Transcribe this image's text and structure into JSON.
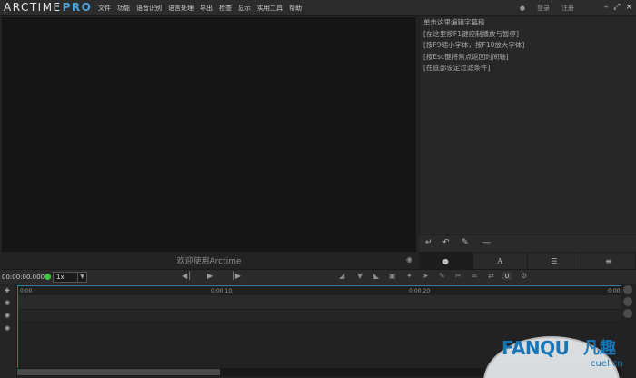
{
  "app": {
    "logo_main": "ARCTIME",
    "logo_accent": "PRO",
    "menu": [
      "文件",
      "功能",
      "语音识别",
      "语言处理",
      "导出",
      "检查",
      "显示",
      "实用工具",
      "帮助"
    ],
    "login": "登录",
    "register": "注册",
    "minimize": "–",
    "maximize": "⤢",
    "close": "×"
  },
  "video": {
    "welcome": "欢迎使用Arctime"
  },
  "editor": {
    "lines": [
      "单击这里编辑字幕稿",
      "[在这里按F1键控制播放与暂停]",
      "[按F9缩小字体，按F10放大字体]",
      "[按Esc键将焦点返回时间轴]",
      "[在底部设定过滤条件]"
    ],
    "tab_font_label": "A"
  },
  "transport": {
    "timecode": "00:00:00.000",
    "speed": "1x"
  },
  "timeline": {
    "ticks": [
      "0:00",
      "0:00:10",
      "0:00:20",
      "0:00"
    ]
  },
  "watermark": {
    "brand": "FANQU",
    "brand_cn": "凡趣",
    "url": "cuel.cn"
  },
  "colors": {
    "accent": "#4ba3d8",
    "status_green": "#3cc43c",
    "playhead": "#c04646"
  }
}
